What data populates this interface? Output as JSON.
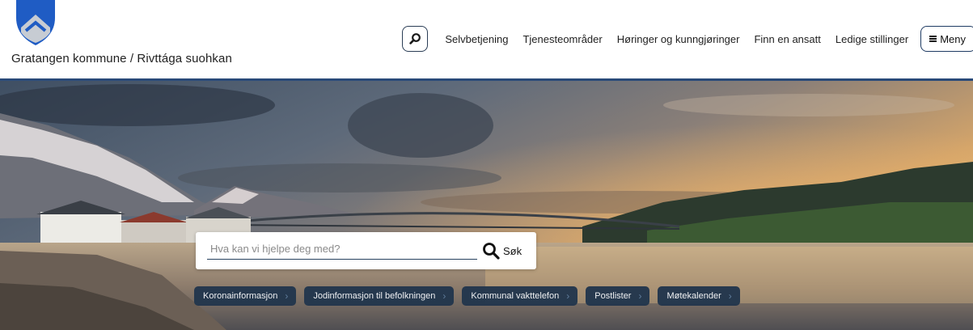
{
  "header": {
    "site_name": "Gratangen kommune / Rivttága suohkan",
    "logo_icon": "coat-of-arms-shield",
    "search_icon": "magnifier-icon",
    "nav": [
      {
        "label": "Selvbetjening"
      },
      {
        "label": "Tjenesteområder"
      },
      {
        "label": "Høringer og kunngjøringer"
      },
      {
        "label": "Finn en ansatt"
      },
      {
        "label": "Ledige stillinger"
      }
    ],
    "menu_label": "Meny",
    "menu_icon": "hamburger-icon"
  },
  "hero": {
    "search": {
      "placeholder": "Hva kan vi hjelpe deg med?",
      "button_label": "Søk"
    },
    "quick_links": [
      {
        "label": "Koronainformasjon"
      },
      {
        "label": "Jodinformasjon til befolkningen"
      },
      {
        "label": "Kommunal vakttelefon"
      },
      {
        "label": "Postlister"
      },
      {
        "label": "Møtekalender"
      }
    ]
  },
  "colors": {
    "accent": "#2a4a78",
    "pill_bg": "#22364d",
    "shield_blue": "#1f5cc4",
    "shield_silver": "#c7ccd3"
  }
}
